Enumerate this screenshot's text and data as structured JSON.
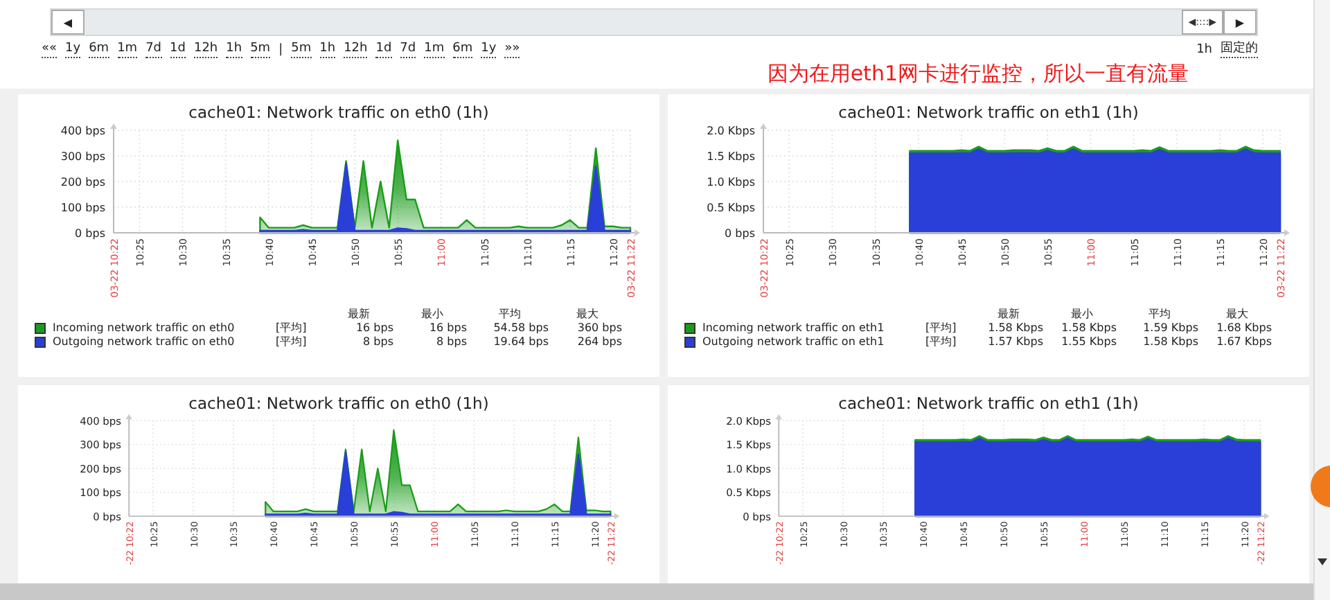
{
  "timeline": {
    "left_button": "◀",
    "right_handle": "◀::::▶",
    "right_button": "▶"
  },
  "time_nav": {
    "back": "««",
    "zoom_back": [
      "1y",
      "6m",
      "1m",
      "7d",
      "1d",
      "12h",
      "1h",
      "5m"
    ],
    "separator": "|",
    "zoom_forward": [
      "5m",
      "1h",
      "12h",
      "1d",
      "7d",
      "1m",
      "6m",
      "1y"
    ],
    "forward": "»»",
    "period": "1h",
    "fixed": "固定的"
  },
  "annotation": "因为在用eth1网卡进行监控，所以一直有流量",
  "graphs": [
    {
      "title": "cache01: Network traffic on eth0 (1h)",
      "chart_data": {
        "type": "area",
        "stacked": false,
        "grid": true,
        "categories": [
          "03-22 10:22",
          null,
          null,
          "10:25",
          null,
          null,
          null,
          null,
          "10:30",
          null,
          null,
          null,
          null,
          "10:35",
          null,
          null,
          null,
          null,
          "10:40",
          null,
          null,
          null,
          null,
          "10:45",
          null,
          null,
          null,
          null,
          "10:50",
          null,
          null,
          null,
          null,
          "10:55",
          null,
          null,
          null,
          null,
          "11:00",
          null,
          null,
          null,
          null,
          "11:05",
          null,
          null,
          null,
          null,
          "11:10",
          null,
          null,
          null,
          null,
          "11:15",
          null,
          null,
          null,
          null,
          "11:20",
          null,
          "03-22 11:22"
        ],
        "ylim": [
          0,
          400
        ],
        "yticks": [
          {
            "value": 0,
            "label": "0 bps"
          },
          {
            "value": 100,
            "label": "100 bps"
          },
          {
            "value": 200,
            "label": "200 bps"
          },
          {
            "value": 300,
            "label": "300 bps"
          },
          {
            "value": 400,
            "label": "400 bps"
          }
        ],
        "series": [
          {
            "name": "Incoming network traffic on eth0",
            "color": "#1a9c1a",
            "values": [
              null,
              null,
              null,
              null,
              null,
              null,
              null,
              null,
              null,
              null,
              null,
              null,
              null,
              null,
              null,
              null,
              null,
              60,
              20,
              20,
              20,
              20,
              30,
              20,
              20,
              20,
              20,
              280,
              20,
              280,
              20,
              200,
              20,
              360,
              130,
              130,
              20,
              20,
              20,
              20,
              20,
              50,
              20,
              20,
              20,
              20,
              20,
              25,
              20,
              20,
              20,
              20,
              30,
              50,
              20,
              20,
              330,
              25,
              25,
              20,
              20
            ]
          },
          {
            "name": "Outgoing network traffic on eth0",
            "color": "#2a3fd8",
            "values": [
              null,
              null,
              null,
              null,
              null,
              null,
              null,
              null,
              null,
              null,
              null,
              null,
              null,
              null,
              null,
              null,
              null,
              8,
              8,
              8,
              8,
              8,
              12,
              8,
              8,
              8,
              8,
              270,
              8,
              8,
              8,
              8,
              8,
              18,
              15,
              8,
              8,
              8,
              8,
              8,
              8,
              8,
              8,
              8,
              8,
              8,
              8,
              8,
              8,
              8,
              8,
              8,
              8,
              8,
              8,
              8,
              260,
              8,
              8,
              8,
              8
            ]
          }
        ]
      },
      "legend": {
        "headers": [
          "最新",
          "最小",
          "平均",
          "最大"
        ],
        "rows": [
          {
            "function": "[平均]",
            "values": [
              "16 bps",
              "16 bps",
              "54.58 bps",
              "360 bps"
            ]
          },
          {
            "function": "[平均]",
            "values": [
              "8 bps",
              "8 bps",
              "19.64 bps",
              "264 bps"
            ]
          }
        ]
      }
    },
    {
      "title": "cache01: Network traffic on eth1 (1h)",
      "chart_data": {
        "type": "area",
        "stacked": false,
        "grid": true,
        "categories": [
          "03-22 10:22",
          null,
          null,
          "10:25",
          null,
          null,
          null,
          null,
          "10:30",
          null,
          null,
          null,
          null,
          "10:35",
          null,
          null,
          null,
          null,
          "10:40",
          null,
          null,
          null,
          null,
          "10:45",
          null,
          null,
          null,
          null,
          "10:50",
          null,
          null,
          null,
          null,
          "10:55",
          null,
          null,
          null,
          null,
          "11:00",
          null,
          null,
          null,
          null,
          "11:05",
          null,
          null,
          null,
          null,
          "11:10",
          null,
          null,
          null,
          null,
          "11:15",
          null,
          null,
          null,
          null,
          "11:20",
          null,
          "03-22 11:22"
        ],
        "ylim": [
          0,
          2
        ],
        "yticks": [
          {
            "value": 0,
            "label": "0 bps"
          },
          {
            "value": 0.5,
            "label": "0.5 Kbps"
          },
          {
            "value": 1,
            "label": "1.0 Kbps"
          },
          {
            "value": 1.5,
            "label": "1.5 Kbps"
          },
          {
            "value": 2,
            "label": "2.0 Kbps"
          }
        ],
        "series": [
          {
            "name": "Incoming network traffic on eth1",
            "color": "#1a9c1a",
            "values": [
              null,
              null,
              null,
              null,
              null,
              null,
              null,
              null,
              null,
              null,
              null,
              null,
              null,
              null,
              null,
              null,
              null,
              1.6,
              1.6,
              1.6,
              1.6,
              1.6,
              1.6,
              1.61,
              1.6,
              1.68,
              1.6,
              1.6,
              1.6,
              1.61,
              1.61,
              1.61,
              1.6,
              1.65,
              1.6,
              1.6,
              1.68,
              1.6,
              1.6,
              1.6,
              1.6,
              1.6,
              1.6,
              1.6,
              1.61,
              1.6,
              1.67,
              1.6,
              1.6,
              1.6,
              1.6,
              1.6,
              1.6,
              1.61,
              1.6,
              1.6,
              1.68,
              1.61,
              1.6,
              1.6,
              1.6
            ]
          },
          {
            "name": "Outgoing network traffic on eth1",
            "color": "#2a3fd8",
            "values": [
              null,
              null,
              null,
              null,
              null,
              null,
              null,
              null,
              null,
              null,
              null,
              null,
              null,
              null,
              null,
              null,
              null,
              1.55,
              1.55,
              1.55,
              1.55,
              1.55,
              1.55,
              1.56,
              1.55,
              1.63,
              1.55,
              1.55,
              1.55,
              1.56,
              1.56,
              1.56,
              1.55,
              1.6,
              1.55,
              1.55,
              1.63,
              1.55,
              1.55,
              1.55,
              1.55,
              1.55,
              1.55,
              1.55,
              1.56,
              1.55,
              1.62,
              1.55,
              1.55,
              1.55,
              1.55,
              1.55,
              1.55,
              1.56,
              1.55,
              1.55,
              1.63,
              1.56,
              1.55,
              1.55,
              1.55
            ]
          }
        ]
      },
      "legend": {
        "headers": [
          "最新",
          "最小",
          "平均",
          "最大"
        ],
        "rows": [
          {
            "function": "[平均]",
            "values": [
              "1.58 Kbps",
              "1.58 Kbps",
              "1.59 Kbps",
              "1.68 Kbps"
            ]
          },
          {
            "function": "[平均]",
            "values": [
              "1.57 Kbps",
              "1.55 Kbps",
              "1.58 Kbps",
              "1.67 Kbps"
            ]
          }
        ]
      }
    },
    {
      "title": "cache01: Network traffic on eth0 (1h)",
      "chart_data": {
        "type": "area",
        "stacked": false,
        "grid": true,
        "categories": [
          "-22 10:22",
          null,
          null,
          "10:25",
          null,
          null,
          null,
          null,
          "10:30",
          null,
          null,
          null,
          null,
          "10:35",
          null,
          null,
          null,
          null,
          "10:40",
          null,
          null,
          null,
          null,
          "10:45",
          null,
          null,
          null,
          null,
          "10:50",
          null,
          null,
          null,
          null,
          "10:55",
          null,
          null,
          null,
          null,
          "11:00",
          null,
          null,
          null,
          null,
          "11:05",
          null,
          null,
          null,
          null,
          "11:10",
          null,
          null,
          null,
          null,
          "11:15",
          null,
          null,
          null,
          null,
          "11:20",
          null,
          "-22 11:22"
        ],
        "ylim": [
          0,
          400
        ],
        "yticks": [
          {
            "value": 0,
            "label": "0 bps"
          },
          {
            "value": 100,
            "label": "100 bps"
          },
          {
            "value": 200,
            "label": "200 bps"
          },
          {
            "value": 300,
            "label": "300 bps"
          },
          {
            "value": 400,
            "label": "400 bps"
          }
        ],
        "series": [
          {
            "color": "#1a9c1a",
            "values": [
              null,
              null,
              null,
              null,
              null,
              null,
              null,
              null,
              null,
              null,
              null,
              null,
              null,
              null,
              null,
              null,
              null,
              60,
              20,
              20,
              20,
              20,
              30,
              20,
              20,
              20,
              20,
              280,
              20,
              280,
              20,
              200,
              20,
              360,
              130,
              130,
              20,
              20,
              20,
              20,
              20,
              50,
              20,
              20,
              20,
              20,
              20,
              25,
              20,
              20,
              20,
              20,
              30,
              50,
              20,
              20,
              330,
              25,
              25,
              20,
              20
            ]
          },
          {
            "color": "#2a3fd8",
            "values": [
              null,
              null,
              null,
              null,
              null,
              null,
              null,
              null,
              null,
              null,
              null,
              null,
              null,
              null,
              null,
              null,
              null,
              8,
              8,
              8,
              8,
              8,
              12,
              8,
              8,
              8,
              8,
              270,
              8,
              8,
              8,
              8,
              8,
              18,
              15,
              8,
              8,
              8,
              8,
              8,
              8,
              8,
              8,
              8,
              8,
              8,
              8,
              8,
              8,
              8,
              8,
              8,
              8,
              8,
              8,
              8,
              260,
              8,
              8,
              8,
              8
            ]
          }
        ]
      }
    },
    {
      "title": "cache01: Network traffic on eth1 (1h)",
      "chart_data": {
        "type": "area",
        "stacked": false,
        "grid": true,
        "categories": [
          "-22 10:22",
          null,
          null,
          "10:25",
          null,
          null,
          null,
          null,
          "10:30",
          null,
          null,
          null,
          null,
          "10:35",
          null,
          null,
          null,
          null,
          "10:40",
          null,
          null,
          null,
          null,
          "10:45",
          null,
          null,
          null,
          null,
          "10:50",
          null,
          null,
          null,
          null,
          "10:55",
          null,
          null,
          null,
          null,
          "11:00",
          null,
          null,
          null,
          null,
          "11:05",
          null,
          null,
          null,
          null,
          "11:10",
          null,
          null,
          null,
          null,
          "11:15",
          null,
          null,
          null,
          null,
          "11:20",
          null,
          "-22 11:22"
        ],
        "ylim": [
          0,
          2
        ],
        "yticks": [
          {
            "value": 0,
            "label": "0 bps"
          },
          {
            "value": 0.5,
            "label": "0.5 Kbps"
          },
          {
            "value": 1,
            "label": "1.0 Kbps"
          },
          {
            "value": 1.5,
            "label": "1.5 Kbps"
          },
          {
            "value": 2,
            "label": "2.0 Kbps"
          }
        ],
        "series": [
          {
            "color": "#1a9c1a",
            "values": [
              null,
              null,
              null,
              null,
              null,
              null,
              null,
              null,
              null,
              null,
              null,
              null,
              null,
              null,
              null,
              null,
              null,
              1.6,
              1.6,
              1.6,
              1.6,
              1.6,
              1.6,
              1.61,
              1.6,
              1.68,
              1.6,
              1.6,
              1.6,
              1.61,
              1.61,
              1.61,
              1.6,
              1.65,
              1.6,
              1.6,
              1.68,
              1.6,
              1.6,
              1.6,
              1.6,
              1.6,
              1.6,
              1.6,
              1.61,
              1.6,
              1.67,
              1.6,
              1.6,
              1.6,
              1.6,
              1.6,
              1.6,
              1.61,
              1.6,
              1.6,
              1.68,
              1.61,
              1.6,
              1.6,
              1.6
            ]
          },
          {
            "color": "#2a3fd8",
            "values": [
              null,
              null,
              null,
              null,
              null,
              null,
              null,
              null,
              null,
              null,
              null,
              null,
              null,
              null,
              null,
              null,
              null,
              1.55,
              1.55,
              1.55,
              1.55,
              1.55,
              1.55,
              1.56,
              1.55,
              1.63,
              1.55,
              1.55,
              1.55,
              1.56,
              1.56,
              1.56,
              1.55,
              1.6,
              1.55,
              1.55,
              1.63,
              1.55,
              1.55,
              1.55,
              1.55,
              1.55,
              1.55,
              1.55,
              1.56,
              1.55,
              1.62,
              1.55,
              1.55,
              1.55,
              1.55,
              1.55,
              1.55,
              1.56,
              1.55,
              1.55,
              1.63,
              1.56,
              1.55,
              1.55,
              1.55
            ]
          }
        ]
      }
    }
  ]
}
